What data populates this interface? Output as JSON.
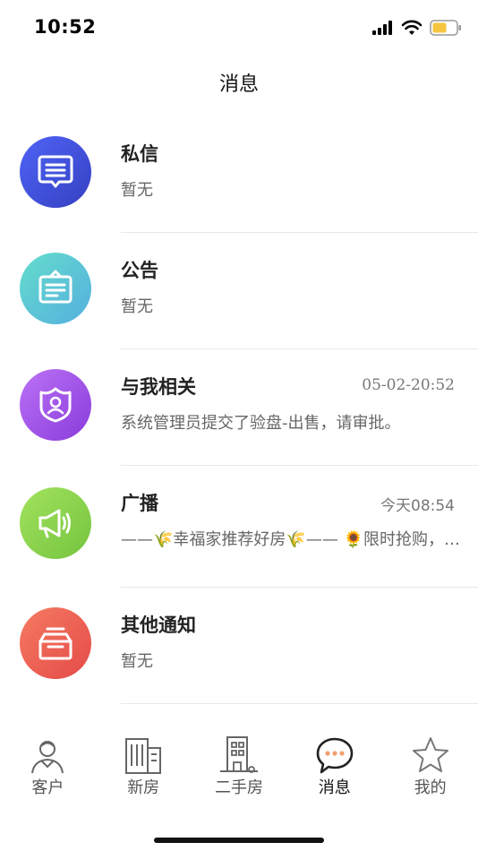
{
  "status_bar": {
    "time": "10:52",
    "icons": [
      "signal-icon",
      "wifi-icon",
      "battery-icon"
    ],
    "battery_color": "#f5c542"
  },
  "header": {
    "title": "消息"
  },
  "messages": [
    {
      "title": "私信",
      "subtitle": "暂无",
      "time": "",
      "icon": "chat-bubble-icon",
      "color_from": "#4a5cf0",
      "color_to": "#3a47c8"
    },
    {
      "title": "公告",
      "subtitle": "暂无",
      "time": "",
      "icon": "notice-board-icon",
      "color_from": "#5fd6cf",
      "color_to": "#58b6dd"
    },
    {
      "title": "与我相关",
      "subtitle": "系统管理员提交了验盘-出售，请审批。",
      "time": "05-02-20:52",
      "icon": "user-shield-icon",
      "color_from": "#b56cf3",
      "color_to": "#8e3ee0"
    },
    {
      "title": "广播",
      "subtitle": "——🌾幸福家推荐好房🌾—— 🌻限时抢购，错过不再🌻",
      "time": "今天08:54",
      "icon": "megaphone-icon",
      "color_from": "#9ddf5a",
      "color_to": "#7ac943"
    },
    {
      "title": "其他通知",
      "subtitle": "暂无",
      "time": "",
      "icon": "inbox-tray-icon",
      "color_from": "#f2725e",
      "color_to": "#e8524a"
    }
  ],
  "tab_bar": {
    "items": [
      {
        "label": "客户",
        "icon": "customer-icon",
        "active": false
      },
      {
        "label": "新房",
        "icon": "new-house-icon",
        "active": false
      },
      {
        "label": "二手房",
        "icon": "second-hand-house-icon",
        "active": false
      },
      {
        "label": "消息",
        "icon": "message-bubble-icon",
        "active": true
      },
      {
        "label": "我的",
        "icon": "star-icon",
        "active": false
      }
    ]
  }
}
